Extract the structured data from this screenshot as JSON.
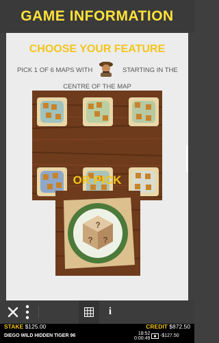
{
  "header": {
    "title": "GAME INFORMATION"
  },
  "panel": {
    "subtitle": "CHOOSE YOUR FEATURE",
    "instruction_part1": "PICK 1 OF 6 MAPS WITH",
    "instruction_part2": "STARTING IN THE",
    "instruction_line2": "CENTRE OF THE MAP",
    "or_pick": "OR PICK"
  },
  "toolbar": {
    "close_icon": "close-icon",
    "menu_icon": "vertical-dots-icon",
    "paytable_icon": "table-icon",
    "info_label": "i"
  },
  "footer": {
    "stake_label": "STAKE",
    "stake_value": "$125.00",
    "credit_label": "CREDIT",
    "credit_value": "$872.50",
    "game_name": "DIEGO WILD HIDDEN TIGER 96",
    "clock": "18:52",
    "session_time": "0:00:49",
    "session_result": "-$127.50"
  },
  "colors": {
    "accent": "#ffe23a",
    "subtitle": "#f3c51a"
  }
}
